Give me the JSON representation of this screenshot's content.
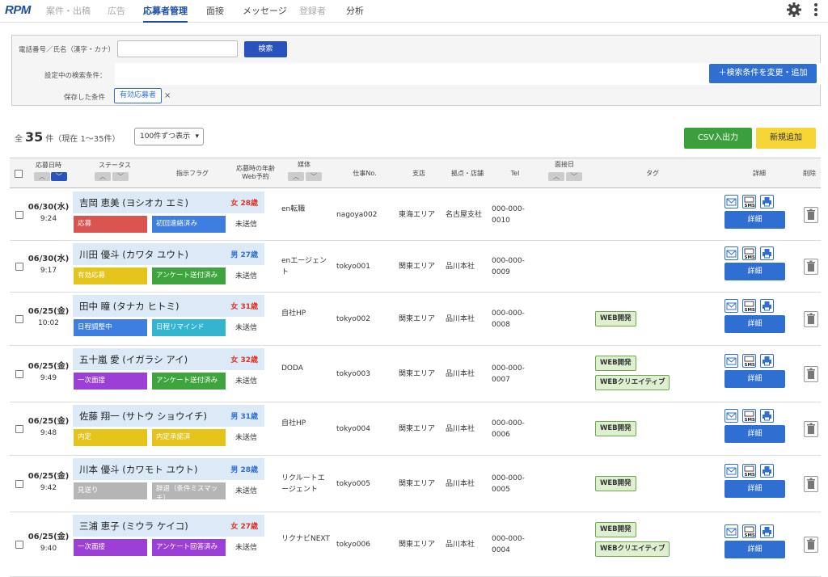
{
  "app": {
    "logo": "RPM"
  },
  "nav": {
    "tabs": [
      {
        "label": "案件・出稿",
        "state": "disabled"
      },
      {
        "label": "広告",
        "state": "disabled"
      },
      {
        "label": "応募者管理",
        "state": "active"
      },
      {
        "label": "面接",
        "state": "normal"
      },
      {
        "label": "メッセージ",
        "state": "normal"
      },
      {
        "label": "登録者",
        "state": "disabled"
      },
      {
        "label": "分析",
        "state": "normal"
      }
    ]
  },
  "search": {
    "phone_name_label": "電話番号／氏名（漢字・カナ）",
    "input_value": "",
    "search_button": "検索",
    "current_conditions_label": "設定中の検索条件：",
    "change_button": "＋検索条件を変更・追加",
    "saved_label": "保存した条件",
    "saved_tag": "有効応募者",
    "saved_remove": "×"
  },
  "summary": {
    "prefix": "全",
    "total": "35",
    "suffix": "件（現在 1〜35件）",
    "per_page": "100件ずつ表示"
  },
  "actions": {
    "csv": "CSV入出力",
    "new": "新規追加"
  },
  "columns": {
    "applied_date": "応募日時",
    "status": "ステータス",
    "flag": "指示フラグ",
    "age_web": "応募時の年齢 Web予約",
    "media": "媒体",
    "job_no": "仕事No.",
    "branch": "支店",
    "location": "拠点・店舗",
    "tel": "Tel",
    "interview": "面接日",
    "tag": "タグ",
    "detail": "詳細",
    "delete": "削除"
  },
  "colors": {
    "primary": "#2f6fd1",
    "csv": "#3ba03b",
    "new": "#f6d535",
    "tag_bg": "#dff0d0"
  },
  "detail_label": "詳細",
  "rows": [
    {
      "date": "06/30(水)",
      "time": "9:24",
      "name": "吉岡 恵美 (ヨシオカ エミ)",
      "age": "女 28歳",
      "sex": "f",
      "status": "応募",
      "status_color": "#d9534f",
      "flag": "初回連絡済み",
      "flag_color": "#3d7ee0",
      "web": "未送信",
      "media": "en転職",
      "job": "nagoya002",
      "branch": "東海エリア",
      "location": "名古屋支社",
      "tel": "000-000-0010",
      "tags": []
    },
    {
      "date": "06/30(水)",
      "time": "9:17",
      "name": "川田 優斗 (カワタ ユウト)",
      "age": "男 27歳",
      "sex": "m",
      "status": "有効応募",
      "status_color": "#e4c31b",
      "flag": "アンケート送付済み",
      "flag_color": "#3ea53e",
      "web": "未送信",
      "media": "enエージェント",
      "job": "tokyo001",
      "branch": "関東エリア",
      "location": "品川本社",
      "tel": "000-000-0009",
      "tags": []
    },
    {
      "date": "06/25(金)",
      "time": "10:02",
      "name": "田中 瞳 (タナカ ヒトミ)",
      "age": "女 31歳",
      "sex": "f",
      "status": "日程調整中",
      "status_color": "#3d7ee0",
      "flag": "日程リマインド",
      "flag_color": "#33b5cf",
      "web": "未送信",
      "media": "自社HP",
      "job": "tokyo002",
      "branch": "関東エリア",
      "location": "品川本社",
      "tel": "000-000-0008",
      "tags": [
        "WEB開発"
      ]
    },
    {
      "date": "06/25(金)",
      "time": "9:49",
      "name": "五十嵐 愛 (イガラシ アイ)",
      "age": "女 32歳",
      "sex": "f",
      "status": "一次面接",
      "status_color": "#9b3fd6",
      "flag": "アンケート送付済み",
      "flag_color": "#3ea53e",
      "web": "未送信",
      "media": "DODA",
      "job": "tokyo003",
      "branch": "関東エリア",
      "location": "品川本社",
      "tel": "000-000-0007",
      "tags": [
        "WEB開発",
        "WEBクリエイティブ"
      ]
    },
    {
      "date": "06/25(金)",
      "time": "9:48",
      "name": "佐藤 翔一 (サトウ ショウイチ)",
      "age": "男 31歳",
      "sex": "m",
      "status": "内定",
      "status_color": "#e4c31b",
      "flag": "内定承諾済",
      "flag_color": "#e4c31b",
      "web": "未送信",
      "media": "自社HP",
      "job": "tokyo004",
      "branch": "関東エリア",
      "location": "品川本社",
      "tel": "000-000-0006",
      "tags": [
        "WEB開発"
      ]
    },
    {
      "date": "06/25(金)",
      "time": "9:42",
      "name": "川本 優斗 (カワモト ユウト)",
      "age": "男 28歳",
      "sex": "m",
      "status": "見送り",
      "status_color": "#b5b5b5",
      "flag": "辞退（条件ミスマッチ）",
      "flag_color": "#b5b5b5",
      "web": "未送信",
      "media": "リクルートエージェント",
      "job": "tokyo005",
      "branch": "関東エリア",
      "location": "品川本社",
      "tel": "000-000-0005",
      "tags": [
        "WEB開発"
      ]
    },
    {
      "date": "06/25(金)",
      "time": "9:40",
      "name": "三浦 恵子 (ミウラ ケイコ)",
      "age": "女 27歳",
      "sex": "f",
      "status": "一次面接",
      "status_color": "#9b3fd6",
      "flag": "アンケート回答済み",
      "flag_color": "#9b3fd6",
      "web": "未送信",
      "media": "リクナビNEXT",
      "job": "tokyo006",
      "branch": "関東エリア",
      "location": "品川本社",
      "tel": "000-000-0004",
      "tags": [
        "WEB開発",
        "WEBクリエイティブ"
      ]
    }
  ]
}
